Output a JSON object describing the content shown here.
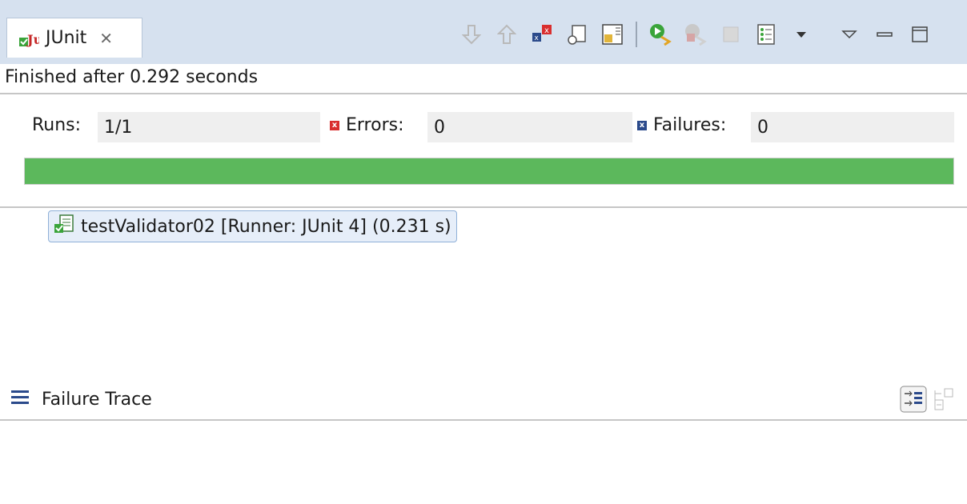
{
  "tab": {
    "title": "JUnit",
    "icon": "junit-icon",
    "close_glyph": "✕"
  },
  "toolbar": {
    "icons": [
      "next-failure-icon",
      "previous-failure-icon",
      "show-failures-only-icon",
      "scroll-lock-icon",
      "layout-icon",
      "rerun-test-icon",
      "rerun-failed-first-icon",
      "stop-icon",
      "history-icon",
      "history-dropdown-icon",
      "view-menu-icon",
      "minimize-icon",
      "maximize-icon"
    ]
  },
  "status": {
    "finished_text": "Finished after 0.292 seconds"
  },
  "counters": {
    "runs_label": "Runs:",
    "runs_value": "1/1",
    "errors_label": "Errors:",
    "errors_value": "0",
    "failures_label": "Failures:",
    "failures_value": "0"
  },
  "progress": {
    "fraction": 1.0,
    "color": "#5cb85c"
  },
  "tree": {
    "items": [
      {
        "label": "testValidator02 [Runner: JUnit 4] (0.231 s)",
        "icon": "test-suite-success-icon"
      }
    ]
  },
  "trace": {
    "title": "Failure Trace",
    "icon": "stack-trace-icon",
    "buttons": [
      "filter-stack-trace-icon",
      "compare-results-icon"
    ]
  },
  "colors": {
    "tab_bar": "#d6e1ef",
    "success": "#5cb85c",
    "error": "#d92e2e",
    "failure": "#2b4a8b"
  }
}
